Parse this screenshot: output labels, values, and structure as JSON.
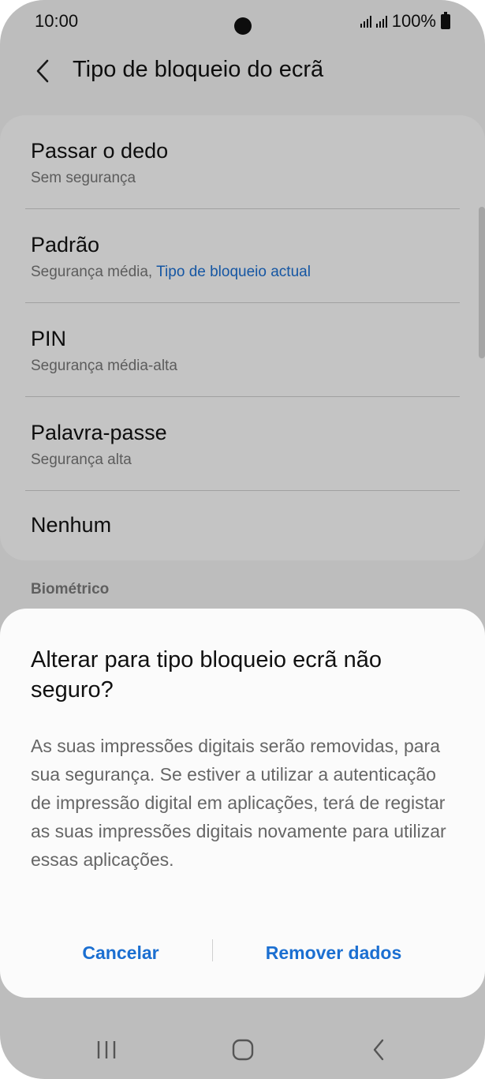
{
  "status_bar": {
    "time": "10:00",
    "battery": "100%"
  },
  "header": {
    "title": "Tipo de bloqueio do ecrã"
  },
  "lock_types": [
    {
      "title": "Passar o dedo",
      "subtitle": "Sem segurança",
      "highlight": ""
    },
    {
      "title": "Padrão",
      "subtitle": "Segurança média,",
      "highlight": "Tipo de bloqueio actual"
    },
    {
      "title": "PIN",
      "subtitle": "Segurança média-alta",
      "highlight": ""
    },
    {
      "title": "Palavra-passe",
      "subtitle": "Segurança alta",
      "highlight": ""
    },
    {
      "title": "Nenhum",
      "subtitle": "",
      "highlight": ""
    }
  ],
  "section": {
    "biometric_label": "Biométrico"
  },
  "dialog": {
    "title": "Alterar para tipo bloqueio ecrã não seguro?",
    "body": "As suas impressões digitais serão removidas, para sua segurança. Se estiver a utilizar a autenticação de impressão digital em aplicações, terá de registar as suas impressões digitais novamente para utilizar essas aplicações.",
    "cancel_label": "Cancelar",
    "confirm_label": "Remover dados"
  },
  "icons": {
    "back": "chevron-left-icon",
    "recents": "recents-icon",
    "home": "home-icon",
    "nav_back": "nav-back-icon"
  },
  "colors": {
    "accent": "#1b6fd1",
    "background": "#f3f3f3",
    "dialog": "#fbfbfb"
  }
}
